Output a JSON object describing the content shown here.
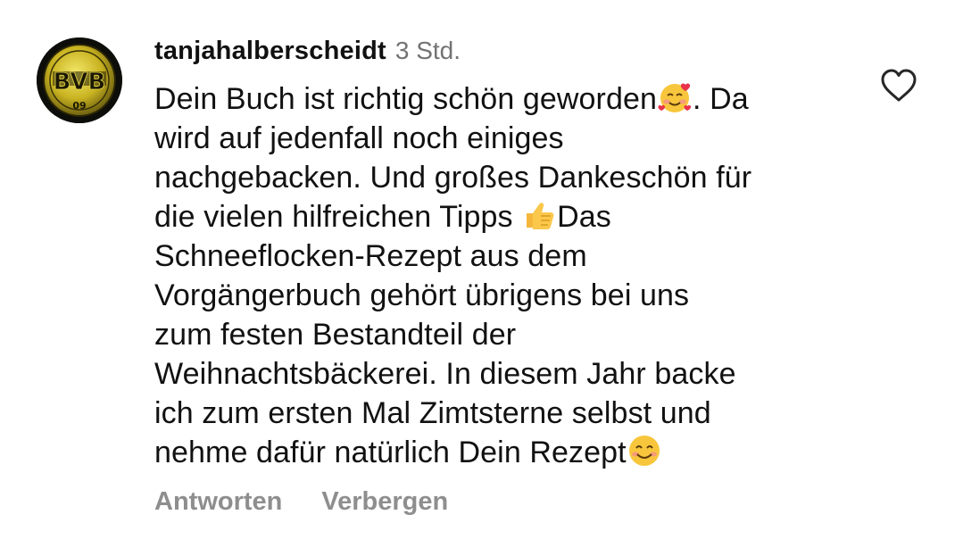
{
  "comment": {
    "username": "tanjahalberscheidt",
    "timestamp": "3 Std.",
    "text_lines": [
      "Dein Buch ist richtig schön geworden",
      ". Da",
      "wird auf jedenfall noch einiges",
      "nachgebacken. Und großes Dankeschön für",
      "die vielen hilfreichen Tipps ",
      "Das",
      "Schneeflocken-Rezept aus dem",
      "Vorgängerbuch gehört übrigens bei uns",
      "zum festen Bestandteil der",
      "Weihnachtsbäckerei. In diesem Jahr backe",
      "ich zum ersten Mal Zimtsterne selbst und",
      "nehme dafür natürlich Dein Rezept"
    ],
    "avatar_lettering": "BVB 09"
  },
  "actions": {
    "reply_label": "Antworten",
    "hide_label": "Verbergen"
  },
  "icons": {
    "like": "heart-outline-icon",
    "emoji_1": "smiling-face-with-hearts-emoji",
    "emoji_2": "thumbs-up-emoji",
    "emoji_3": "smiling-face-with-smiling-eyes-emoji"
  },
  "colors": {
    "text": "#111111",
    "meta": "#737373",
    "action": "#8e8e8e",
    "avatar_gold": "#d8c531"
  }
}
